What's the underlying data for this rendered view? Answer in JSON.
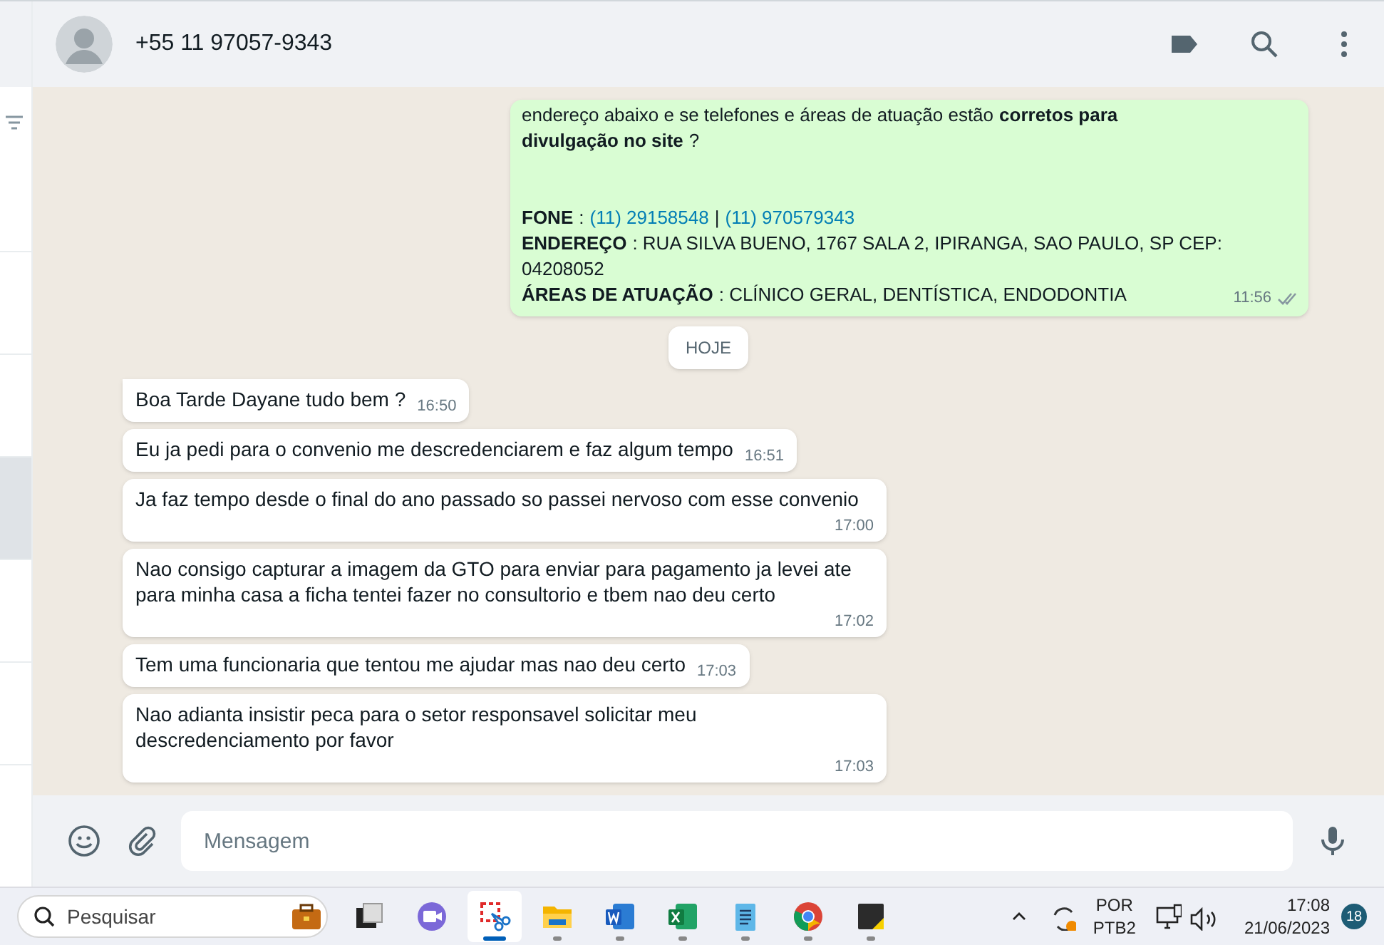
{
  "header": {
    "contact": "+55 11 97057-9343"
  },
  "sidebar": {
    "items": [
      {
        "selected": false
      },
      {
        "selected": false
      },
      {
        "selected": false
      },
      {
        "selected": true
      },
      {
        "selected": false
      },
      {
        "selected": false
      }
    ]
  },
  "outgoing": {
    "time": "11:56",
    "delivered": true,
    "paragraphs": [
      [
        {
          "parts": [
            {
              "kind": "plain",
              "text": "endereço abaixo e se telefones e áreas de atuação estão "
            },
            {
              "kind": "bold",
              "text": "corretos para"
            }
          ]
        },
        {
          "parts": [
            {
              "kind": "bold",
              "text": "divulgação no site"
            },
            {
              "kind": "plain",
              "text": "?"
            }
          ]
        }
      ],
      [
        {
          "parts": [
            {
              "kind": "bold",
              "text": "FONE"
            },
            {
              "kind": "plain",
              "text": ":"
            },
            {
              "kind": "link",
              "text": "(11) 29158548"
            },
            {
              "kind": "plain",
              "text": "|"
            },
            {
              "kind": "link",
              "text": "(11) 970579343"
            }
          ]
        },
        {
          "parts": [
            {
              "kind": "bold",
              "text": "ENDEREÇO"
            },
            {
              "kind": "plain",
              "text": ": RUA SILVA BUENO, 1767 SALA 2, IPIRANGA, SAO PAULO, SP CEP:"
            }
          ]
        },
        {
          "parts": [
            {
              "kind": "plain",
              "text": "04208052"
            }
          ]
        },
        {
          "parts": [
            {
              "kind": "bold",
              "text": "ÁREAS DE ATUAÇÃO"
            },
            {
              "kind": "plain",
              "text": ": CLÍNICO GERAL, DENTÍSTICA, ENDODONTIA"
            }
          ]
        }
      ]
    ]
  },
  "date_divider": "HOJE",
  "messages": [
    {
      "text": "Boa Tarde Dayane tudo bem ?",
      "time": "16:50",
      "first": true
    },
    {
      "text": "Eu ja pedi para o convenio me descredenciarem e faz algum tempo",
      "time": "16:51",
      "first": false
    },
    {
      "text": "Ja faz tempo desde o final do ano passado so passei nervoso com esse convenio",
      "time": "17:00",
      "first": false
    },
    {
      "text": "Nao consigo capturar a imagem da GTO para enviar para pagamento ja levei ate para minha casa a ficha tentei fazer no consultorio e tbem nao deu certo",
      "time": "17:02",
      "first": false
    },
    {
      "text": "Tem uma funcionaria que tentou me ajudar mas nao deu certo",
      "time": "17:03",
      "first": false
    },
    {
      "text": "Nao adianta insistir peca para o setor responsavel solicitar meu descredenciamento por favor",
      "time": "17:03",
      "first": false
    }
  ],
  "composer": {
    "placeholder": "Mensagem"
  },
  "taskbar": {
    "search_placeholder": "Pesquisar",
    "apps": [
      {
        "kind": "taskview",
        "selected": false,
        "running": false
      },
      {
        "kind": "meet",
        "selected": false,
        "running": false
      },
      {
        "kind": "snip",
        "selected": true,
        "running": true
      },
      {
        "kind": "folder",
        "selected": false,
        "running": true
      },
      {
        "kind": "word",
        "selected": false,
        "running": true
      },
      {
        "kind": "excel",
        "selected": false,
        "running": true
      },
      {
        "kind": "notepad",
        "selected": false,
        "running": true
      },
      {
        "kind": "chrome",
        "selected": false,
        "running": true
      },
      {
        "kind": "sticky",
        "selected": false,
        "running": true
      }
    ],
    "language": [
      "POR",
      "PTB2"
    ],
    "time": "17:08",
    "date": "21/06/2023",
    "badge": "18"
  }
}
